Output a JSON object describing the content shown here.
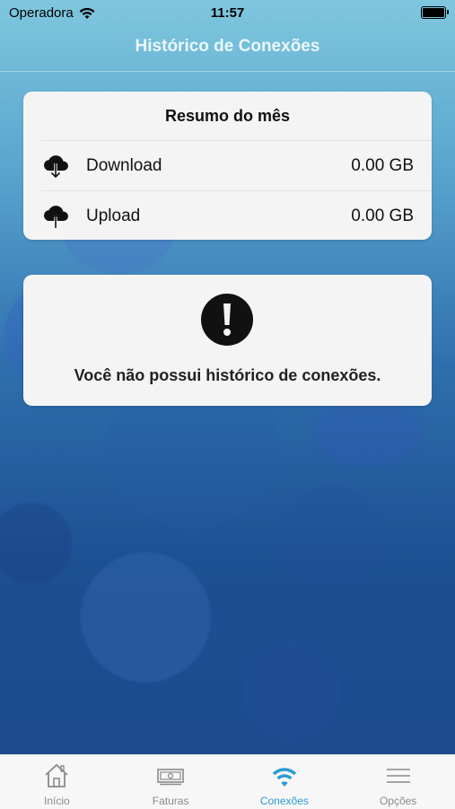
{
  "status_bar": {
    "carrier": "Operadora",
    "time": "11:57",
    "wifi_icon": "wifi-icon",
    "battery_icon": "battery-icon"
  },
  "nav": {
    "title": "Histórico de Conexões"
  },
  "summary": {
    "title": "Resumo do mês",
    "rows": [
      {
        "icon": "cloud-download-icon",
        "label": "Download",
        "value": "0.00 GB"
      },
      {
        "icon": "cloud-upload-icon",
        "label": "Upload",
        "value": "0.00 GB"
      }
    ]
  },
  "empty_state": {
    "icon": "exclamation-icon",
    "message": "Você não possui histórico de conexões."
  },
  "tabs": [
    {
      "icon": "home-icon",
      "label": "Início",
      "active": false
    },
    {
      "icon": "invoice-icon",
      "label": "Faturas",
      "active": false
    },
    {
      "icon": "wifi-icon",
      "label": "Conexões",
      "active": true
    },
    {
      "icon": "menu-icon",
      "label": "Opções",
      "active": false
    }
  ],
  "colors": {
    "accent": "#2a9bd6",
    "inactive_tab": "#8a8a8a",
    "card_bg": "#f4f4f4"
  }
}
